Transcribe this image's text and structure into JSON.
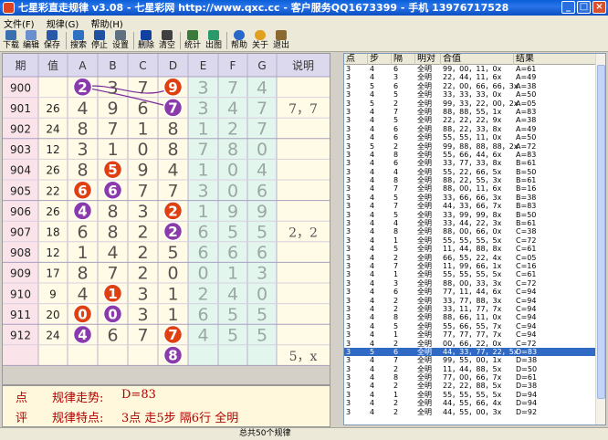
{
  "window": {
    "title": "七星彩直走规律 v3.08 - 七星彩网 http://www.qxc.cc - 客户服务QQ1673399 - 手机 13976717528"
  },
  "menu": [
    "文件(F)",
    "规律(G)",
    "帮助(H)"
  ],
  "toolbar": [
    "下载",
    "编辑",
    "保存",
    "搜索",
    "停止",
    "设置",
    "删除",
    "清空",
    "统计",
    "出图",
    "帮助",
    "关于",
    "退出"
  ],
  "grid": {
    "headers": [
      "期",
      "值",
      "A",
      "B",
      "C",
      "D",
      "E",
      "F",
      "G",
      "说明"
    ],
    "rows": [
      {
        "period": "900",
        "sum": "",
        "digits": [
          "2",
          "3",
          "7",
          "9",
          "3",
          "7",
          "4",
          "4"
        ],
        "note": ""
      },
      {
        "period": "901",
        "sum": "26",
        "digits": [
          "4",
          "9",
          "6",
          "7",
          "3",
          "4",
          "7"
        ],
        "note": "7，7"
      },
      {
        "period": "902",
        "sum": "24",
        "digits": [
          "8",
          "7",
          "1",
          "8",
          "1",
          "2",
          "7"
        ],
        "note": ""
      },
      {
        "period": "903",
        "sum": "12",
        "digits": [
          "3",
          "1",
          "0",
          "8",
          "7",
          "8",
          "0"
        ],
        "note": ""
      },
      {
        "period": "904",
        "sum": "26",
        "digits": [
          "8",
          "5",
          "9",
          "4",
          "1",
          "0",
          "4"
        ],
        "note": ""
      },
      {
        "period": "905",
        "sum": "22",
        "digits": [
          "6",
          "6",
          "7",
          "7",
          "3",
          "0",
          "6"
        ],
        "note": ""
      },
      {
        "period": "906",
        "sum": "26",
        "digits": [
          "4",
          "8",
          "3",
          "2",
          "1",
          "9",
          "9"
        ],
        "note": ""
      },
      {
        "period": "907",
        "sum": "18",
        "digits": [
          "6",
          "8",
          "2",
          "2",
          "6",
          "5",
          "5"
        ],
        "note": "2，2"
      },
      {
        "period": "908",
        "sum": "12",
        "digits": [
          "1",
          "4",
          "2",
          "5",
          "6",
          "6",
          "6"
        ],
        "note": ""
      },
      {
        "period": "909",
        "sum": "17",
        "digits": [
          "8",
          "7",
          "2",
          "0",
          "0",
          "1",
          "3"
        ],
        "note": ""
      },
      {
        "period": "910",
        "sum": "9",
        "digits": [
          "4",
          "1",
          "3",
          "1",
          "2",
          "4",
          "0"
        ],
        "note": ""
      },
      {
        "period": "911",
        "sum": "20",
        "digits": [
          "0",
          "0",
          "3",
          "1",
          "6",
          "5",
          "5"
        ],
        "note": ""
      },
      {
        "period": "912",
        "sum": "24",
        "digits": [
          "4",
          "6",
          "7",
          "7",
          "4",
          "5",
          "5"
        ],
        "note": ""
      },
      {
        "period": "",
        "sum": "",
        "digits": [
          "",
          "",
          "",
          "8",
          "",
          "",
          ""
        ],
        "note": "5，x"
      }
    ]
  },
  "bottom": {
    "dian": "点",
    "ping": "评",
    "trend_label": "规律走势:",
    "trend_value": "D=83",
    "feature_label": "规律特点:",
    "feature_value": "3点 走5步 隔6行 全明"
  },
  "list": {
    "headers": [
      "点",
      "步",
      "隔",
      "明对",
      "合值",
      "结果"
    ],
    "rows": [
      [
        "3",
        "4",
        "6",
        "全明",
        "99，00，11，0x",
        "A=61"
      ],
      [
        "3",
        "4",
        "3",
        "全明",
        "22，44，11，6x",
        "A=49"
      ],
      [
        "3",
        "5",
        "6",
        "全明",
        "22，00，66，66，3x",
        "A=38"
      ],
      [
        "3",
        "4",
        "5",
        "全明",
        "33，33，33，0x",
        "A=50"
      ],
      [
        "3",
        "5",
        "2",
        "全明",
        "99，33，22，00，2x",
        "A=05"
      ],
      [
        "3",
        "4",
        "7",
        "全明",
        "88，88，55，1x",
        "A=83"
      ],
      [
        "3",
        "4",
        "5",
        "全明",
        "22，22，22，9x",
        "A=38"
      ],
      [
        "3",
        "4",
        "6",
        "全明",
        "88，22，33，8x",
        "A=49"
      ],
      [
        "3",
        "4",
        "6",
        "全明",
        "55，55，11，0x",
        "A=50"
      ],
      [
        "3",
        "5",
        "2",
        "全明",
        "99，88，88，88，2x",
        "A=72"
      ],
      [
        "3",
        "4",
        "8",
        "全明",
        "55，66，44，6x",
        "A=83"
      ],
      [
        "3",
        "4",
        "6",
        "全明",
        "33，77，33，8x",
        "B=61"
      ],
      [
        "3",
        "4",
        "4",
        "全明",
        "55，22，66，5x",
        "B=50"
      ],
      [
        "3",
        "4",
        "8",
        "全明",
        "88，22，55，3x",
        "B=61"
      ],
      [
        "3",
        "4",
        "7",
        "全明",
        "88，00，11，6x",
        "B=16"
      ],
      [
        "3",
        "4",
        "5",
        "全明",
        "33，66，66，3x",
        "B=38"
      ],
      [
        "3",
        "4",
        "7",
        "全明",
        "44，33，66，7x",
        "B=83"
      ],
      [
        "3",
        "4",
        "5",
        "全明",
        "33，99，99，8x",
        "B=50"
      ],
      [
        "3",
        "4",
        "4",
        "全明",
        "33，44，22，3x",
        "B=61"
      ],
      [
        "3",
        "4",
        "8",
        "全明",
        "88，00，66，0x",
        "C=38"
      ],
      [
        "3",
        "4",
        "1",
        "全明",
        "55，55，55，5x",
        "C=72"
      ],
      [
        "3",
        "4",
        "5",
        "全明",
        "11，44，88，8x",
        "C=61"
      ],
      [
        "3",
        "4",
        "2",
        "全明",
        "66，55，22，4x",
        "C=05"
      ],
      [
        "3",
        "4",
        "7",
        "全明",
        "11，99，66，1x",
        "C=16"
      ],
      [
        "3",
        "4",
        "1",
        "全明",
        "55，55，55，5x",
        "C=61"
      ],
      [
        "3",
        "4",
        "3",
        "全明",
        "88，00，33，3x",
        "C=72"
      ],
      [
        "3",
        "4",
        "6",
        "全明",
        "77，11，44，6x",
        "C=94"
      ],
      [
        "3",
        "4",
        "2",
        "全明",
        "33，77，88，3x",
        "C=94"
      ],
      [
        "3",
        "4",
        "2",
        "全明",
        "33，11，77，7x",
        "C=94"
      ],
      [
        "3",
        "4",
        "8",
        "全明",
        "88，66，11，0x",
        "C=94"
      ],
      [
        "3",
        "4",
        "5",
        "全明",
        "55，66，55，7x",
        "C=94"
      ],
      [
        "3",
        "4",
        "1",
        "全明",
        "77，77，77，7x",
        "C=94"
      ],
      [
        "3",
        "4",
        "2",
        "全明",
        "00，66，22，0x",
        "C=72"
      ],
      [
        "3",
        "5",
        "6",
        "全明",
        "44，33，77，22，5x",
        "D=83"
      ],
      [
        "3",
        "4",
        "7",
        "全明",
        "99，55，00，1x",
        "D=38"
      ],
      [
        "3",
        "4",
        "2",
        "全明",
        "11，44，88，5x",
        "D=50"
      ],
      [
        "3",
        "4",
        "8",
        "全明",
        "77，00，66，7x",
        "D=61"
      ],
      [
        "3",
        "4",
        "2",
        "全明",
        "22，22，88，5x",
        "D=38"
      ],
      [
        "3",
        "4",
        "1",
        "全明",
        "55，55，55，5x",
        "D=94"
      ],
      [
        "3",
        "4",
        "2",
        "全明",
        "44，55，66，4x",
        "D=94"
      ],
      [
        "3",
        "4",
        "2",
        "全明",
        "44，55，00，3x",
        "D=92"
      ]
    ],
    "selected_index": 33
  },
  "status": {
    "text": "总共50个规律"
  }
}
